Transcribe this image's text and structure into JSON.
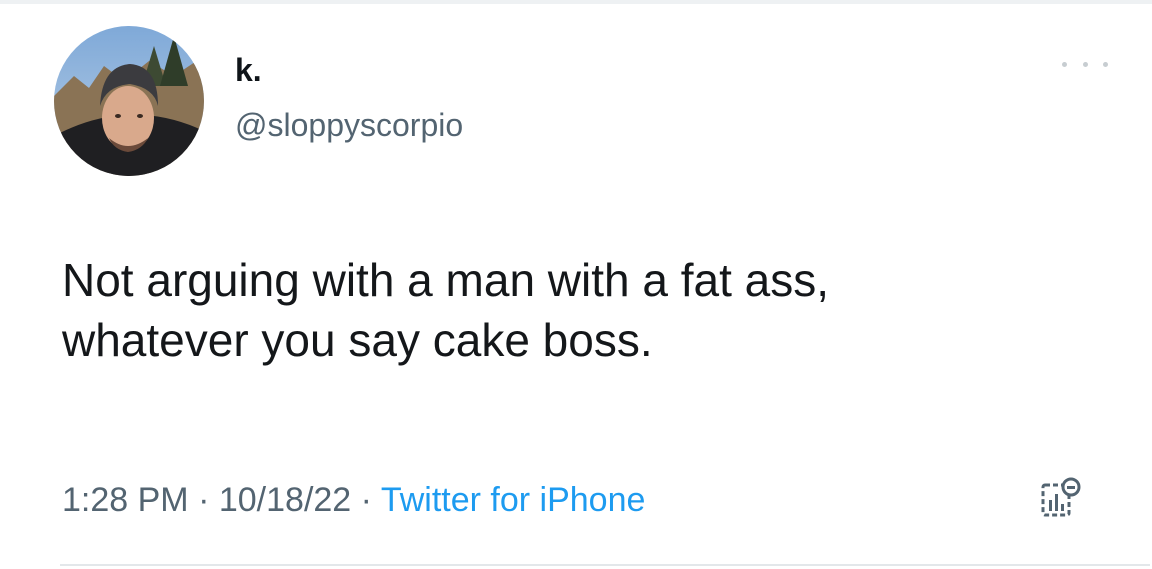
{
  "tweet": {
    "display_name": "k.",
    "username": "@sloppyscorpio",
    "text_line1": "Not arguing with a man with a fat ass,",
    "text_line2": "whatever you say cake boss.",
    "time": "1:28 PM",
    "separator": "·",
    "date": "10/18/22",
    "source": "Twitter for iPhone"
  },
  "icons": {
    "avatar": "profile-photo",
    "more": "more-options-icon",
    "analytics": "tweet-analytics-icon"
  },
  "colors": {
    "primary_text": "#0f1419",
    "secondary_text": "#536471",
    "link": "#1d9bf0"
  }
}
